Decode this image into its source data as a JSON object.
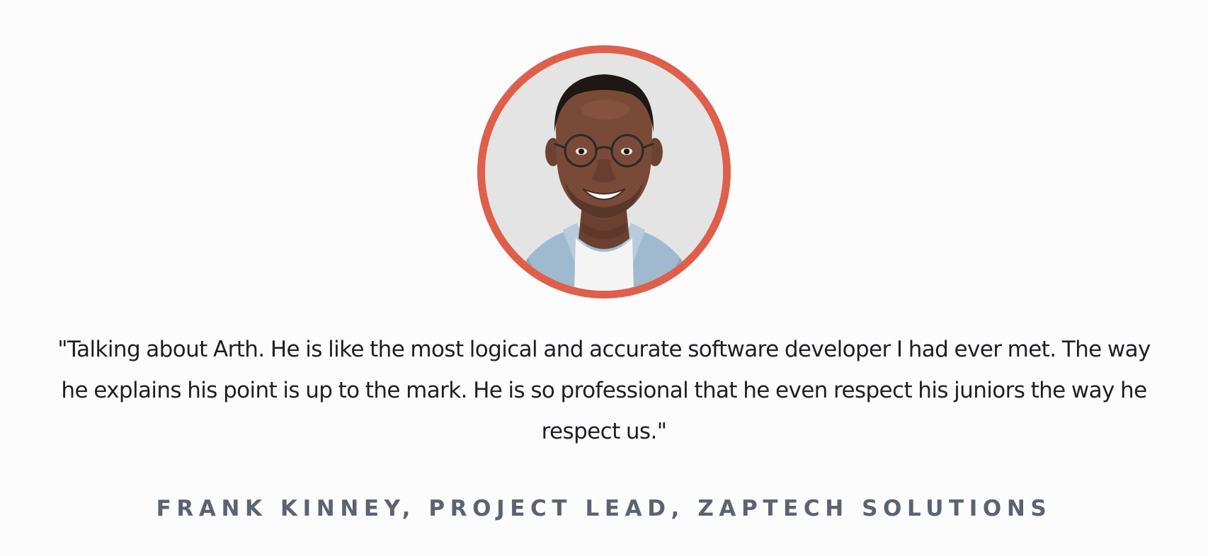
{
  "testimonial": {
    "quote": "\"Talking about Arth. He is like the most logical and accurate software developer I had ever met. The way he explains his point is up to the mark. He is so professional that he even respect his juniors the way he respect us.\"",
    "author": "FRANK KINNEY, PROJECT LEAD, ZAPTECH SOLUTIONS"
  },
  "colors": {
    "background": "#fcfcfd",
    "ring": "#df5f4a",
    "quote_text": "#1d1f24",
    "author_text": "#5c6370"
  },
  "icons": {
    "avatar": "portrait-photo"
  }
}
